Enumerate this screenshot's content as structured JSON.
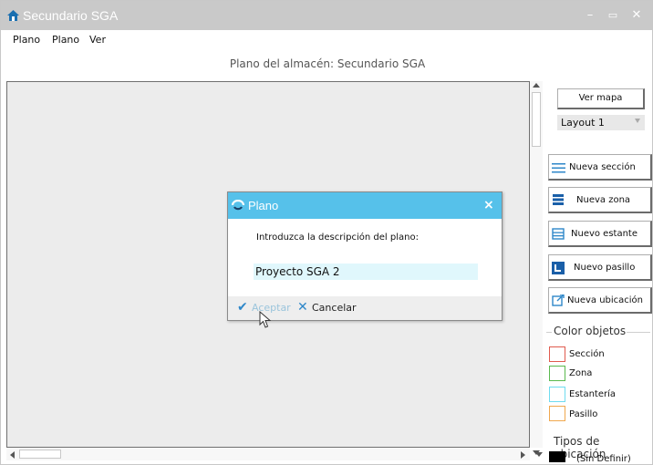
{
  "window": {
    "title": "Secundario SGA",
    "controls": {
      "minimize": "–",
      "maximize": "▭",
      "close": "✕"
    }
  },
  "menu": {
    "items": [
      "Plano",
      "Plano",
      "Ver"
    ]
  },
  "page_title": "Plano del almacén: Secundario SGA",
  "sidebar": {
    "view_map_button": "Ver mapa",
    "layout_select": {
      "value": "Layout 1"
    },
    "tools": [
      {
        "label": "Nueva sección",
        "icon": "lines-icon"
      },
      {
        "label": "Nueva zona",
        "icon": "stack-icon"
      },
      {
        "label": "Nuevo estante",
        "icon": "shelf-icon"
      },
      {
        "label": "Nuevo pasillo",
        "icon": "aisle-icon"
      },
      {
        "label": "Nueva ubicación",
        "icon": "location-icon"
      }
    ],
    "color_group": {
      "title": "Color objetos",
      "items": [
        {
          "label": "Sección",
          "color": "#e05a4e"
        },
        {
          "label": "Zona",
          "color": "#5ab94e"
        },
        {
          "label": "Estantería",
          "color": "#6fdcf0"
        },
        {
          "label": "Pasillo",
          "color": "#f0a84e"
        }
      ]
    },
    "types_group": {
      "title": "Tipos de ubicación",
      "first_item": "(Sin Definir)"
    }
  },
  "dialog": {
    "title": "Plano",
    "close": "×",
    "prompt": "Introduzca la descripción del plano:",
    "input_value": "Proyecto SGA 2",
    "accept_label": "Aceptar",
    "cancel_label": "Cancelar",
    "accept_mark": "✔",
    "cancel_mark": "✕"
  },
  "colors": {
    "titlebar": "#c9c9c9",
    "dialog_header": "#56c1ea",
    "accent": "#2e87c9",
    "canvas": "#ececec"
  }
}
